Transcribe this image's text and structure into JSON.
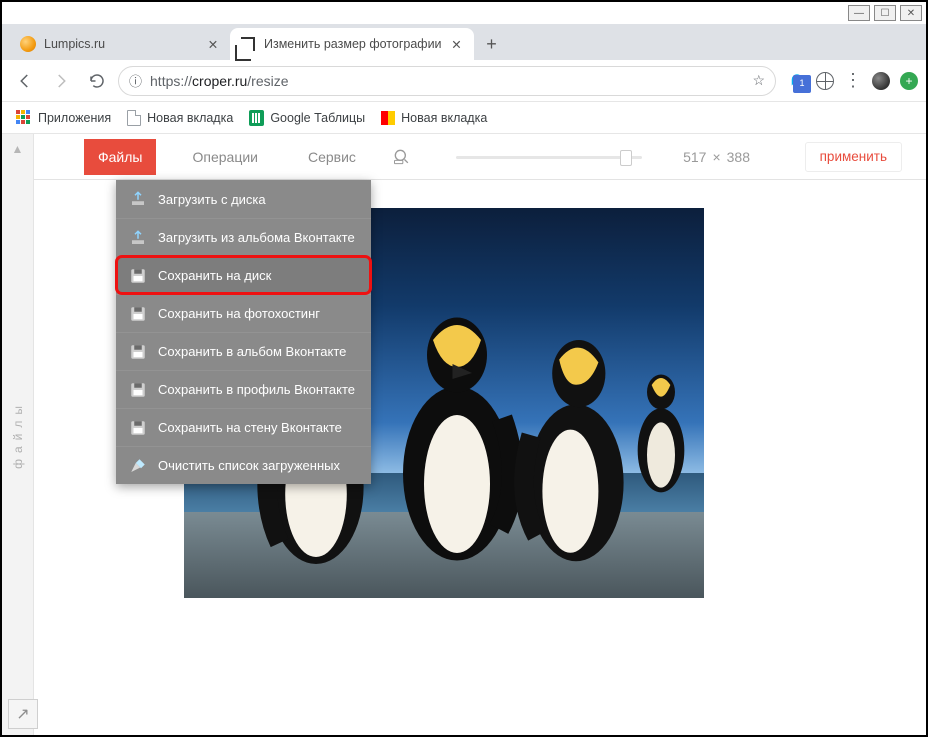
{
  "window_controls": {
    "min": "—",
    "max": "☐",
    "close": "✕"
  },
  "tabs": [
    {
      "title": "Lumpics.ru",
      "active": false
    },
    {
      "title": "Изменить размер фотографии",
      "active": true
    }
  ],
  "url": {
    "info_glyph": "ⓘ",
    "scheme": "https://",
    "host": "croper.ru",
    "path": "/resize",
    "star": "☆"
  },
  "ghostery_badge": "1",
  "bookmarks": {
    "apps": "Приложения",
    "items": [
      "Новая вкладка",
      "Google Таблицы",
      "Новая вкладка"
    ]
  },
  "sidebar_label": "файлы",
  "appmenu": {
    "files": "Файлы",
    "operations": "Операции",
    "service": "Сервис"
  },
  "dims": {
    "w": "517",
    "sep": "×",
    "h": "388"
  },
  "apply_label": "применить",
  "dropdown": {
    "items": [
      "Загрузить с диска",
      "Загрузить из альбома Вконтакте",
      "Сохранить на диск",
      "Сохранить на фотохостинг",
      "Сохранить в альбом Вконтакте",
      "Сохранить в профиль Вконтакте",
      "Сохранить на стену Вконтакте",
      "Очистить список загруженных"
    ],
    "highlight_index": 2
  },
  "corner_glyph": "↗"
}
